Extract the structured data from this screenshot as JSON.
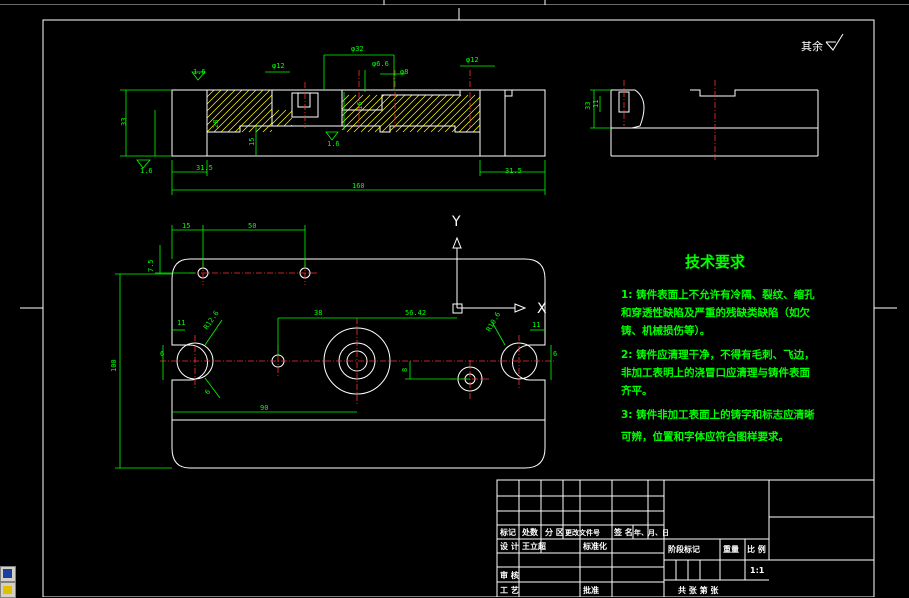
{
  "colors": {
    "background": "#000000",
    "outline": "#ffffff",
    "dimension": "#00ff00",
    "centerline": "#ff3030",
    "hatch": "#ffff00",
    "tech_title": "#00ff00"
  },
  "drawing": {
    "roughness_note": "其余",
    "section_view": {
      "dims": {
        "d_phi32": "φ32",
        "d_phi12_left": "φ12",
        "d_phi12_right": "φ12",
        "d_phi6": "φ6.6",
        "d_phi8": "φ8",
        "h33": "33",
        "h28": "28",
        "h15": "15",
        "h16": "16",
        "w31_5": "31.5",
        "w31_5b": "31.5",
        "w160": "160",
        "r16_left": "1.6",
        "r16_bottom": "1.6",
        "r16_mid": "1.6"
      }
    },
    "side_view": {
      "dims": {
        "h33": "33",
        "h11": "11"
      }
    },
    "plan_view": {
      "dims": {
        "w15": "15",
        "w50": "50",
        "h7_5": "7.5",
        "w38": "38",
        "w56_42": "56.42",
        "w11": "11",
        "w11r": "11",
        "r12_6": "R12.6",
        "r10_6": "R10.6",
        "d6": "6",
        "w90": "90",
        "h100": "100",
        "h6": "6",
        "h6r": "6",
        "h8": "8"
      },
      "axis_y": "Y",
      "axis_x": "X"
    }
  },
  "tech": {
    "title": "技术要求",
    "lines": [
      "1: 铸件表面上不允许有冷隔、裂纹、缩孔",
      "和穿透性缺陷及严重的残缺类缺陷（如欠",
      "铸、机械损伤等）。",
      "2: 铸件应清理干净，不得有毛刺、飞边，",
      "非加工表明上的浇冒口应清理与铸件表面",
      "齐平。",
      "3: 铸件非加工表面上的铸字和标志应清晰",
      "可辨，位置和字体应符合图样要求。"
    ]
  },
  "title_block": {
    "h_mark": "标记",
    "h_count": "处数",
    "h_zone": "分 区",
    "h_docno": "更改文件号",
    "h_sign": "签 名",
    "h_date": "年、月、日",
    "design": "设 计",
    "designer": "王立超",
    "standard": "标准化",
    "stage": "阶段标记",
    "weight": "重量",
    "scale": "比 例",
    "scale_val": "1:1",
    "review": "审 核",
    "process": "工 艺",
    "approve": "批准",
    "sheets": "共    张 第    张"
  }
}
